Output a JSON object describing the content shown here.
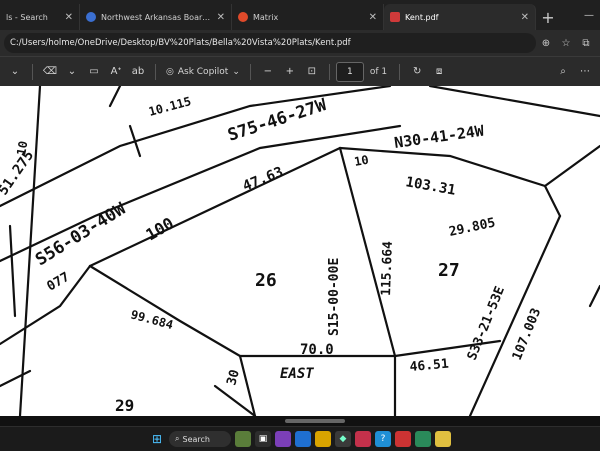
{
  "tabs": [
    {
      "label": "ls - Search",
      "active": false,
      "favicon_color": "#4aa0e8"
    },
    {
      "label": "Northwest Arkansas Board of /",
      "active": false,
      "favicon_color": "#3b6fd1"
    },
    {
      "label": "Matrix",
      "active": false,
      "favicon_color": "#e04a2a"
    },
    {
      "label": "Kent.pdf",
      "active": true,
      "favicon_color": "#d03a3a"
    }
  ],
  "address": {
    "url": "C:/Users/holme/OneDrive/Desktop/BV%20Plats/Bella%20Vista%20Plats/Kent.pdf"
  },
  "toolbar": {
    "copilot_label": "Ask Copilot",
    "page_current": "1",
    "page_total": "of 1"
  },
  "plat": {
    "texts": [
      {
        "t": "S75-46-27W"
      },
      {
        "t": "N30-41-24W"
      },
      {
        "t": "S56-03-40W"
      },
      {
        "t": "100"
      },
      {
        "t": "47.63"
      },
      {
        "t": "10"
      },
      {
        "t": "103.31"
      },
      {
        "t": "29.805"
      },
      {
        "t": "S15-00-00E"
      },
      {
        "t": "115.664"
      },
      {
        "t": "26"
      },
      {
        "t": "27"
      },
      {
        "t": "99.684"
      },
      {
        "t": "70.0"
      },
      {
        "t": "EAST"
      },
      {
        "t": "46.51"
      },
      {
        "t": "S33-21-53E"
      },
      {
        "t": "107.003"
      },
      {
        "t": "29"
      },
      {
        "t": "30"
      },
      {
        "t": "51.275"
      },
      {
        "t": "10.115"
      },
      {
        "t": "10"
      },
      {
        "t": "077"
      }
    ]
  },
  "taskbar": {
    "search_label": "Search"
  }
}
